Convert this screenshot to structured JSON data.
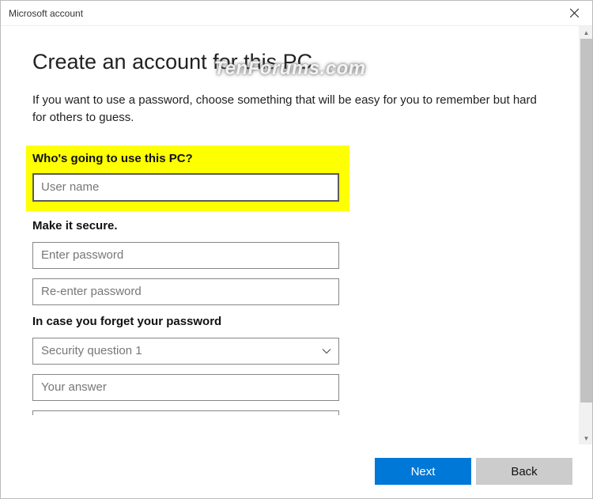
{
  "window": {
    "title": "Microsoft account"
  },
  "watermark": "TenForums.com",
  "page": {
    "heading": "Create an account for this PC",
    "subtitle": "If you want to use a password, choose something that will be easy for you to remember but hard for others to guess."
  },
  "sections": {
    "who": {
      "title": "Who's going to use this PC?",
      "username_placeholder": "User name",
      "username_value": ""
    },
    "secure": {
      "title": "Make it secure.",
      "password_placeholder": "Enter password",
      "reenter_placeholder": "Re-enter password"
    },
    "forgot": {
      "title": "In case you forget your password",
      "question_label": "Security question 1",
      "answer_placeholder": "Your answer"
    }
  },
  "buttons": {
    "next": "Next",
    "back": "Back"
  }
}
